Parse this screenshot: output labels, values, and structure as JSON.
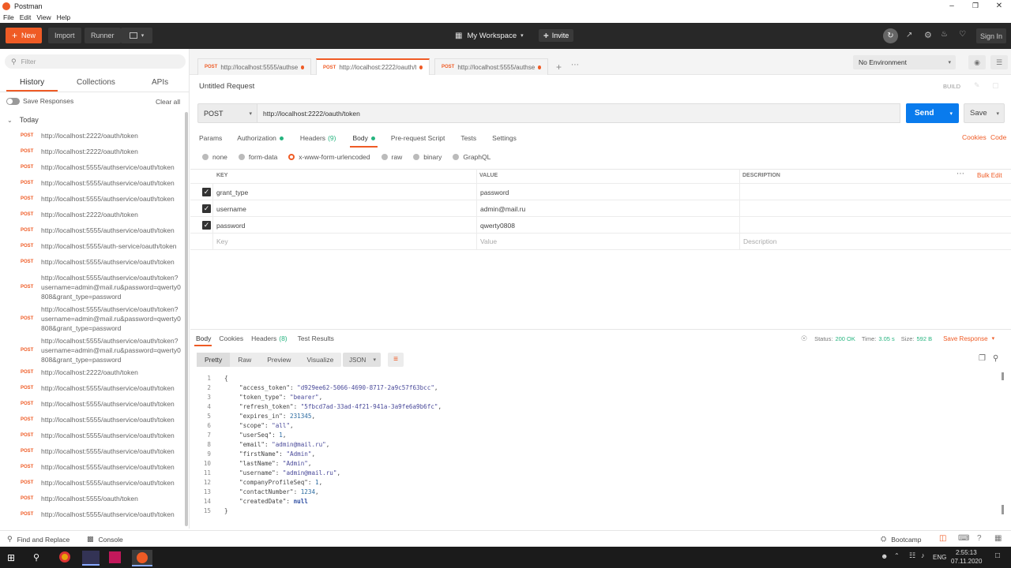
{
  "window": {
    "title": "Postman"
  },
  "menu": [
    "File",
    "Edit",
    "View",
    "Help"
  ],
  "appbar": {
    "new_label": "New",
    "import_label": "Import",
    "runner_label": "Runner",
    "workspace_label": "My Workspace",
    "invite_label": "Invite",
    "signin_label": "Sign In"
  },
  "sidebar": {
    "filter_placeholder": "Filter",
    "tabs": [
      "History",
      "Collections",
      "APIs"
    ],
    "save_responses": "Save Responses",
    "clear_all": "Clear all",
    "group": "Today",
    "items": [
      {
        "method": "POST",
        "url": "http://localhost:2222/oauth/token"
      },
      {
        "method": "POST",
        "url": "http://localhost:2222/oauth/token"
      },
      {
        "method": "POST",
        "url": "http://localhost:5555/authservice/oauth/token"
      },
      {
        "method": "POST",
        "url": "http://localhost:5555/authservice/oauth/token"
      },
      {
        "method": "POST",
        "url": "http://localhost:5555/authservice/oauth/token"
      },
      {
        "method": "POST",
        "url": "http://localhost:2222/oauth/token"
      },
      {
        "method": "POST",
        "url": "http://localhost:5555/authservice/oauth/token"
      },
      {
        "method": "POST",
        "url": "http://localhost:5555/auth-service/oauth/token"
      },
      {
        "method": "POST",
        "url": "http://localhost:5555/authservice/oauth/token"
      },
      {
        "method": "POST",
        "url": "http://localhost:5555/authservice/oauth/token?\nusername=admin@mail.ru&password=qwerty0\n808&grant_type=password"
      },
      {
        "method": "POST",
        "url": "http://localhost:5555/authservice/oauth/token?\nusername=admin@mail.ru&password=qwerty0\n808&grant_type=password"
      },
      {
        "method": "POST",
        "url": "http://localhost:5555/authservice/oauth/token?\nusername=admin@mail.ru&password=qwerty0\n808&grant_type=password"
      },
      {
        "method": "POST",
        "url": "http://localhost:2222/oauth/token"
      },
      {
        "method": "POST",
        "url": "http://localhost:5555/authservice/oauth/token"
      },
      {
        "method": "POST",
        "url": "http://localhost:5555/authservice/oauth/token"
      },
      {
        "method": "POST",
        "url": "http://localhost:5555/authservice/oauth/token"
      },
      {
        "method": "POST",
        "url": "http://localhost:5555/authservice/oauth/token"
      },
      {
        "method": "POST",
        "url": "http://localhost:5555/authservice/oauth/token"
      },
      {
        "method": "POST",
        "url": "http://localhost:5555/authservice/oauth/token"
      },
      {
        "method": "POST",
        "url": "http://localhost:5555/authservice/oauth/token"
      },
      {
        "method": "POST",
        "url": "http://localhost:5555/oauth/token"
      },
      {
        "method": "POST",
        "url": "http://localhost:5555/authservice/oauth/token"
      }
    ]
  },
  "tabs": [
    {
      "method": "POST",
      "label": "http://localhost:5555/authserv..."
    },
    {
      "method": "POST",
      "label": "http://localhost:2222/oauth/to..."
    },
    {
      "method": "POST",
      "label": "http://localhost:5555/authserv..."
    }
  ],
  "environment": "No Environment",
  "request": {
    "title": "Untitled Request",
    "build": "BUILD",
    "method": "POST",
    "url": "http://localhost:2222/oauth/token",
    "send": "Send",
    "save": "Save",
    "subtabs": [
      "Params",
      "Authorization",
      "Headers",
      "(9)",
      "Body",
      "Pre-request Script",
      "Tests",
      "Settings"
    ],
    "cookies": "Cookies",
    "code": "Code",
    "body_types": [
      "none",
      "form-data",
      "x-www-form-urlencoded",
      "raw",
      "binary",
      "GraphQL"
    ],
    "table_headers": [
      "KEY",
      "VALUE",
      "DESCRIPTION"
    ],
    "bulk_edit": "Bulk Edit",
    "rows": [
      {
        "key": "grant_type",
        "value": "password"
      },
      {
        "key": "username",
        "value": "admin@mail.ru"
      },
      {
        "key": "password",
        "value": "qwerty0808"
      }
    ],
    "placeholders": {
      "key": "Key",
      "value": "Value",
      "description": "Description"
    }
  },
  "response": {
    "tabs": [
      "Body",
      "Cookies",
      "Headers",
      "(8)",
      "Test Results"
    ],
    "status_label": "Status:",
    "status": "200 OK",
    "time_label": "Time:",
    "time": "3.05 s",
    "size_label": "Size:",
    "size": "592 B",
    "save_response": "Save Response",
    "views": [
      "Pretty",
      "Raw",
      "Preview",
      "Visualize"
    ],
    "format": "JSON",
    "lines": [
      {
        "n": "1",
        "t": "{"
      },
      {
        "n": "2",
        "k": "\"access_token\": ",
        "v": "\"d929ee62-5066-4690-8717-2a9c57f63bcc\"",
        "c": ","
      },
      {
        "n": "3",
        "k": "\"token_type\": ",
        "v": "\"bearer\"",
        "c": ","
      },
      {
        "n": "4",
        "k": "\"refresh_token\": ",
        "v": "\"5fbcd7ad-33ad-4f21-941a-3a9fe6a9b6fc\"",
        "c": ","
      },
      {
        "n": "5",
        "k": "\"expires_in\": ",
        "n2": "231345",
        "c": ","
      },
      {
        "n": "6",
        "k": "\"scope\": ",
        "v": "\"all\"",
        "c": ","
      },
      {
        "n": "7",
        "k": "\"userSeq\": ",
        "n2": "1",
        "c": ","
      },
      {
        "n": "8",
        "k": "\"email\": ",
        "v": "\"admin@mail.ru\"",
        "c": ","
      },
      {
        "n": "9",
        "k": "\"firstName\": ",
        "v": "\"Admin\"",
        "c": ","
      },
      {
        "n": "10",
        "k": "\"lastName\": ",
        "v": "\"Admin\"",
        "c": ","
      },
      {
        "n": "11",
        "k": "\"username\": ",
        "v": "\"admin@mail.ru\"",
        "c": ","
      },
      {
        "n": "12",
        "k": "\"companyProfileSeq\": ",
        "n2": "1",
        "c": ","
      },
      {
        "n": "13",
        "k": "\"contactNumber\": ",
        "n2": "1234",
        "c": ","
      },
      {
        "n": "14",
        "k": "\"createdDate\": ",
        "kw": "null",
        "c": ""
      },
      {
        "n": "15",
        "t": "}"
      }
    ]
  },
  "statusbar": {
    "find_replace": "Find and Replace",
    "console": "Console",
    "bootcamp": "Bootcamp"
  },
  "taskbar": {
    "lang": "ENG",
    "time": "2:55:13",
    "date": "07.11.2020"
  },
  "colors": {
    "accent": "#ef5b25",
    "send": "#097bed",
    "dark": "#282828",
    "ok": "#26b47f"
  }
}
